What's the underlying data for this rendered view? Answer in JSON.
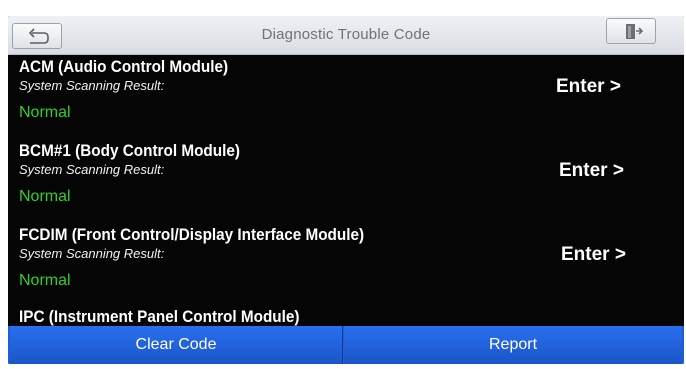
{
  "header": {
    "title": "Diagnostic Trouble Code",
    "back_icon": "back-arrow-icon",
    "exit_icon": "exit-door-icon"
  },
  "modules": [
    {
      "name": "ACM (Audio Control Module)",
      "scan_label": "System Scanning Result:",
      "status": "Normal",
      "enter_label": "Enter >"
    },
    {
      "name": "BCM#1 (Body Control Module)",
      "scan_label": "System Scanning Result:",
      "status": "Normal",
      "enter_label": "Enter >"
    },
    {
      "name": "FCDIM (Front Control/Display Interface Module)",
      "scan_label": "System Scanning Result:",
      "status": "Normal",
      "enter_label": "Enter >"
    }
  ],
  "partial_module_name": "IPC (Instrument Panel Control Module)",
  "footer": {
    "clear_label": "Clear Code",
    "report_label": "Report"
  },
  "colors": {
    "background": "#050505",
    "status_normal": "#32d12a",
    "button_blue": "#1d5fd6",
    "titlebar": "#e2e5ea"
  }
}
